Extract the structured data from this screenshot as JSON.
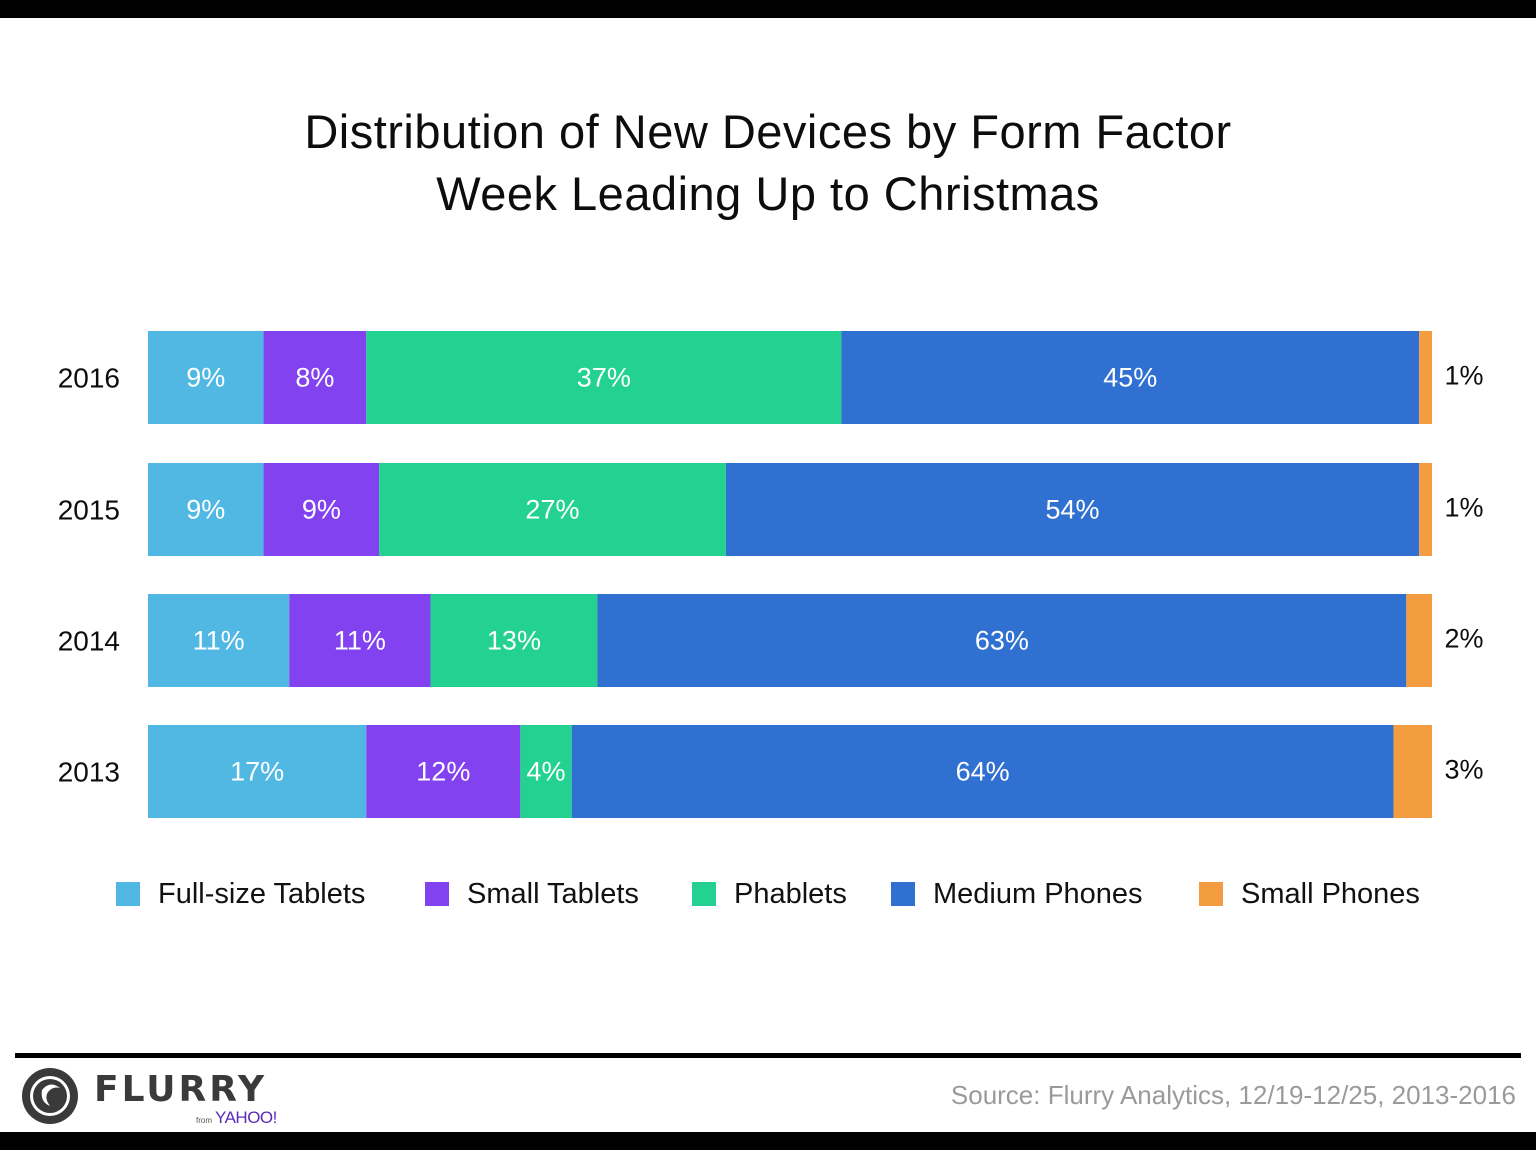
{
  "chart_data": {
    "type": "bar",
    "orientation": "horizontal",
    "stacked": true,
    "title": "Distribution of New Devices by Form Factor",
    "subtitle": "Week Leading Up to Christmas",
    "categories": [
      "2016",
      "2015",
      "2014",
      "2013"
    ],
    "series": [
      {
        "name": "Full-size Tablets",
        "color": "#50b8e3",
        "values": [
          9,
          9,
          11,
          17
        ]
      },
      {
        "name": "Small Tablets",
        "color": "#8342f0",
        "values": [
          8,
          9,
          11,
          12
        ]
      },
      {
        "name": "Phablets",
        "color": "#23d290",
        "values": [
          37,
          27,
          13,
          4
        ]
      },
      {
        "name": "Medium Phones",
        "color": "#3070d0",
        "values": [
          45,
          54,
          63,
          64
        ]
      },
      {
        "name": "Small Phones",
        "color": "#f49c40",
        "values": [
          1,
          1,
          2,
          3
        ]
      }
    ],
    "value_suffix": "%",
    "xlim": [
      0,
      100
    ],
    "xlabel": "",
    "ylabel": "",
    "grid": false,
    "legend_position": "bottom"
  },
  "title_line1": "Distribution of New Devices by Form Factor",
  "title_line2": "Week Leading Up to Christmas",
  "legend": [
    {
      "label": "Full-size Tablets",
      "color": "#50b8e3"
    },
    {
      "label": "Small Tablets",
      "color": "#8342f0"
    },
    {
      "label": "Phablets",
      "color": "#23d290"
    },
    {
      "label": "Medium Phones",
      "color": "#3070d0"
    },
    {
      "label": "Small Phones",
      "color": "#f49c40"
    }
  ],
  "footer": {
    "logo_text": "FLURRY",
    "logo_from": "from",
    "logo_yahoo": "YAHOO!",
    "source": "Source: Flurry Analytics, 12/19-12/25, 2013-2016"
  }
}
